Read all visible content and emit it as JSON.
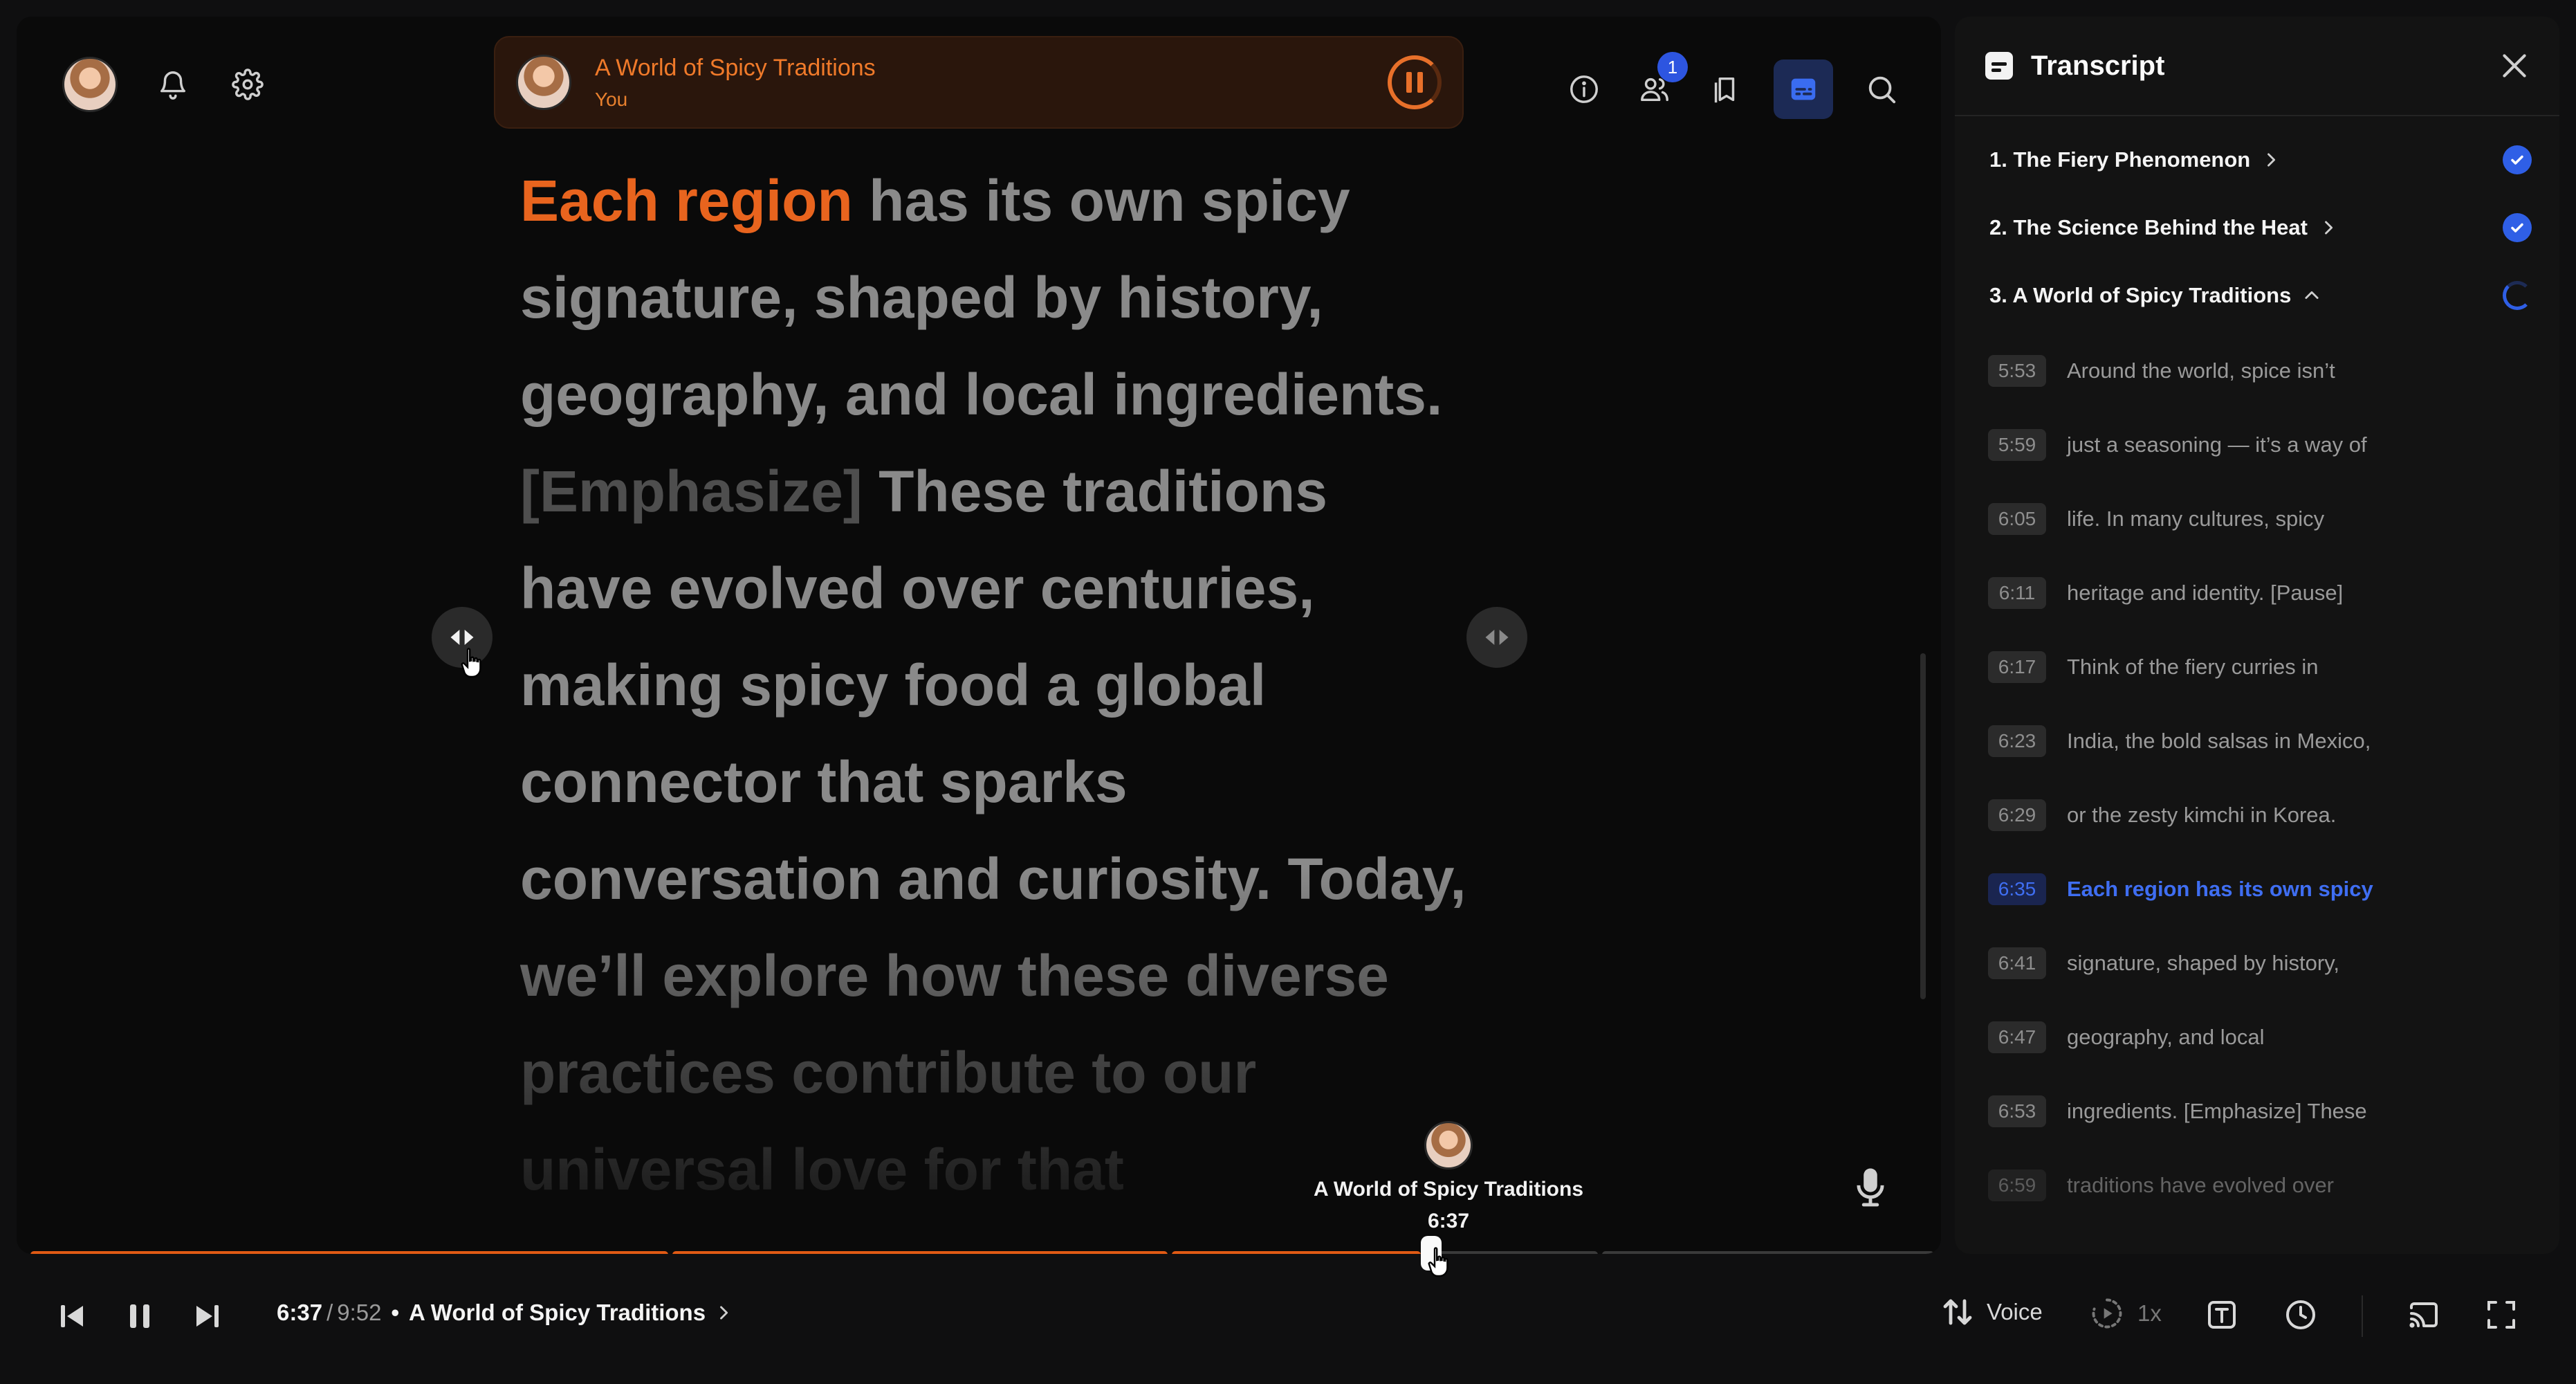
{
  "now_playing": {
    "title": "A World of Spicy Traditions",
    "subtitle": "You"
  },
  "header": {
    "participants_badge": "1"
  },
  "reading": {
    "highlight": "Each region",
    "p1": " has its own spicy signature, shaped by history, geography, and local ingredients. ",
    "tag": "[Emphasize]",
    "p2": " These traditions have evolved over centuries, making spicy food a global connector that sparks conversation and curiosity. Today, we’ll explore how these diverse practices contribute to our universal love for that "
  },
  "seek_tooltip": {
    "title": "A World of Spicy Traditions",
    "time": "6:37"
  },
  "progress": {
    "played_color": "#e05a14",
    "unplayed_color": "#3a3a3a",
    "position_fraction": 0.6747
  },
  "transcript": {
    "title": "Transcript",
    "chapters": [
      {
        "label": "1. The Fiery Phenomenon",
        "status": "complete"
      },
      {
        "label": "2. The Science Behind the Heat",
        "status": "complete"
      },
      {
        "label": "3. A World of Spicy Traditions",
        "status": "in-progress"
      }
    ],
    "lines": [
      {
        "time": "5:53",
        "text": "Around the world, spice isn’t"
      },
      {
        "time": "5:59",
        "text": "just a seasoning — it’s a way of"
      },
      {
        "time": "6:05",
        "text": "life. In many cultures, spicy"
      },
      {
        "time": "6:11",
        "text": "heritage and identity. [Pause]"
      },
      {
        "time": "6:17",
        "text": "Think of the fiery curries in"
      },
      {
        "time": "6:23",
        "text": "India, the bold salsas in Mexico,"
      },
      {
        "time": "6:29",
        "text": "or the zesty kimchi in Korea."
      },
      {
        "time": "6:35",
        "text": "Each region has its own spicy"
      },
      {
        "time": "6:41",
        "text": "signature, shaped by history,"
      },
      {
        "time": "6:47",
        "text": "geography, and local"
      },
      {
        "time": "6:53",
        "text": "ingredients. [Emphasize] These"
      },
      {
        "time": "6:59",
        "text": "traditions have evolved over"
      }
    ]
  },
  "controls": {
    "current_time": "6:37",
    "separator": "/",
    "total_time": "9:52",
    "bullet": "•",
    "chapter_title": "A World of Spicy Traditions",
    "voice_label": "Voice",
    "speed_label": "1x"
  },
  "colors": {
    "accent_orange": "#e8641e",
    "accent_blue": "#2f5fe6",
    "background": "#0a0a0a"
  }
}
